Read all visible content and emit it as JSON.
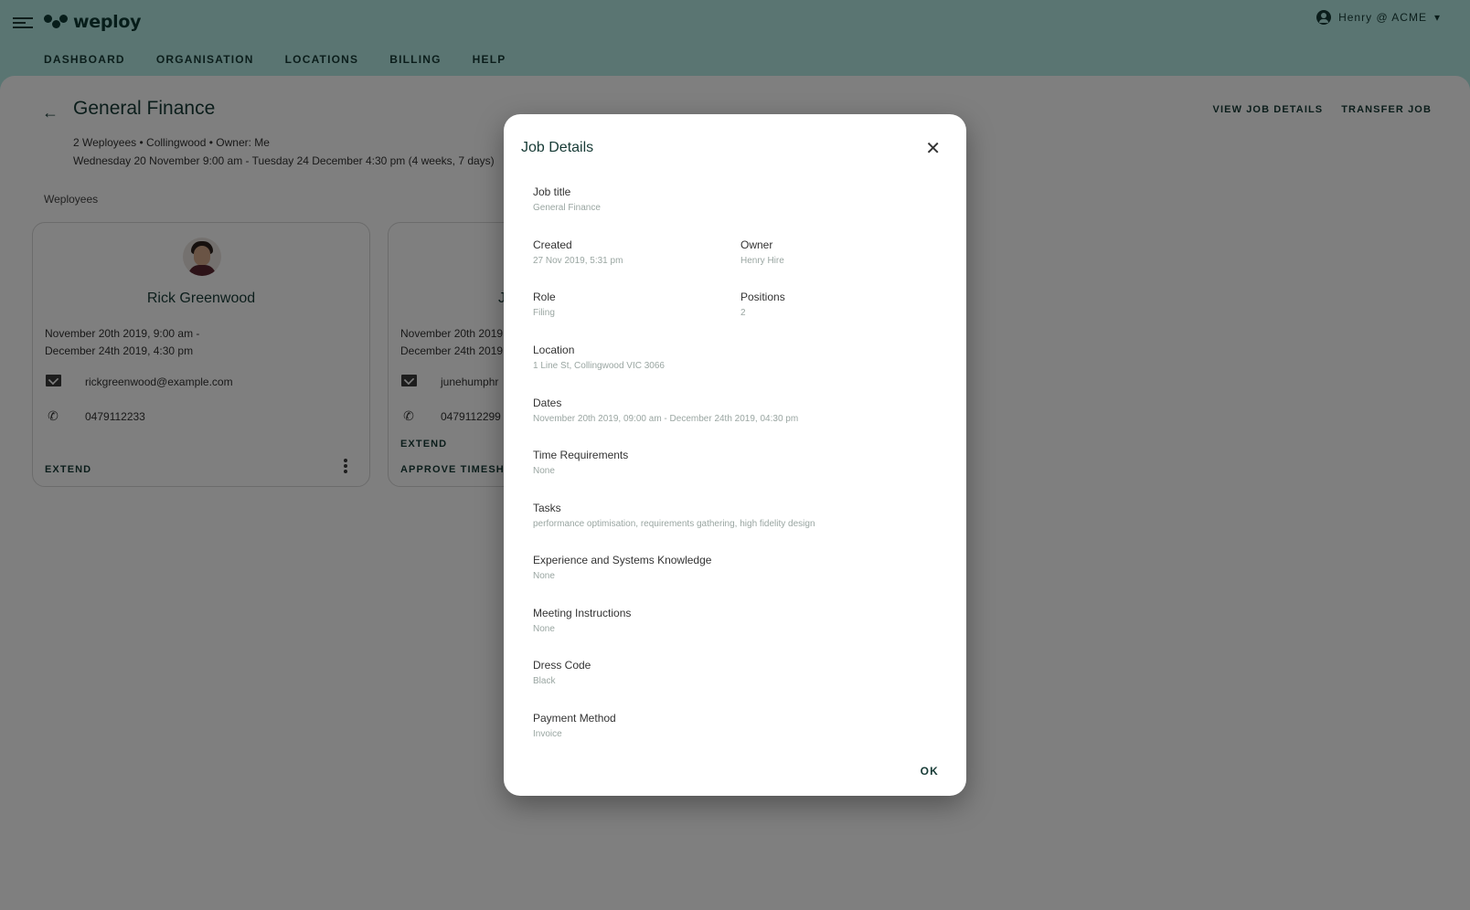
{
  "app": {
    "logo_text": "weploy",
    "user_label": "Henry @ ACME"
  },
  "nav": [
    "DASHBOARD",
    "ORGANISATION",
    "LOCATIONS",
    "BILLING",
    "HELP"
  ],
  "page": {
    "title": "General Finance",
    "actions": [
      "VIEW JOB DETAILS",
      "TRANSFER JOB"
    ],
    "meta_line1": "2 Weployees • Collingwood • Owner: Me",
    "meta_line2": "Wednesday 20 November 9:00 am - Tuesday 24 December 4:30 pm (4 weeks, 7 days)",
    "section_label": "Weployees"
  },
  "weployees": [
    {
      "name": "Rick Greenwood",
      "date_start": "November 20th 2019, 9:00 am -",
      "date_end": "December 24th 2019, 4:30 pm",
      "email": "rickgreenwood@example.com",
      "phone": "0479112233",
      "actions": [
        "EXTEND"
      ]
    },
    {
      "name": "J",
      "date_start": "November 20th 2019",
      "date_end": "December 24th 2019",
      "email": "junehumphr",
      "phone": "0479112299",
      "actions": [
        "EXTEND",
        "APPROVE TIMESH"
      ]
    }
  ],
  "dialog": {
    "title": "Job Details",
    "ok_label": "OK",
    "fields": {
      "job_title": {
        "label": "Job title",
        "value": "General Finance"
      },
      "created": {
        "label": "Created",
        "value": "27 Nov 2019, 5:31 pm"
      },
      "owner": {
        "label": "Owner",
        "value": "Henry Hire"
      },
      "role": {
        "label": "Role",
        "value": "Filing"
      },
      "positions": {
        "label": "Positions",
        "value": "2"
      },
      "location": {
        "label": "Location",
        "value": "1 Line St, Collingwood VIC 3066"
      },
      "dates": {
        "label": "Dates",
        "value": "November 20th 2019, 09:00 am - December 24th 2019, 04:30 pm"
      },
      "time_requirements": {
        "label": "Time Requirements",
        "value": "None"
      },
      "tasks": {
        "label": "Tasks",
        "value": "performance optimisation, requirements gathering, high fidelity design"
      },
      "experience": {
        "label": "Experience and Systems Knowledge",
        "value": "None"
      },
      "meeting": {
        "label": "Meeting Instructions",
        "value": "None"
      },
      "dress_code": {
        "label": "Dress Code",
        "value": "Black"
      },
      "payment": {
        "label": "Payment Method",
        "value": "Invoice"
      }
    }
  }
}
